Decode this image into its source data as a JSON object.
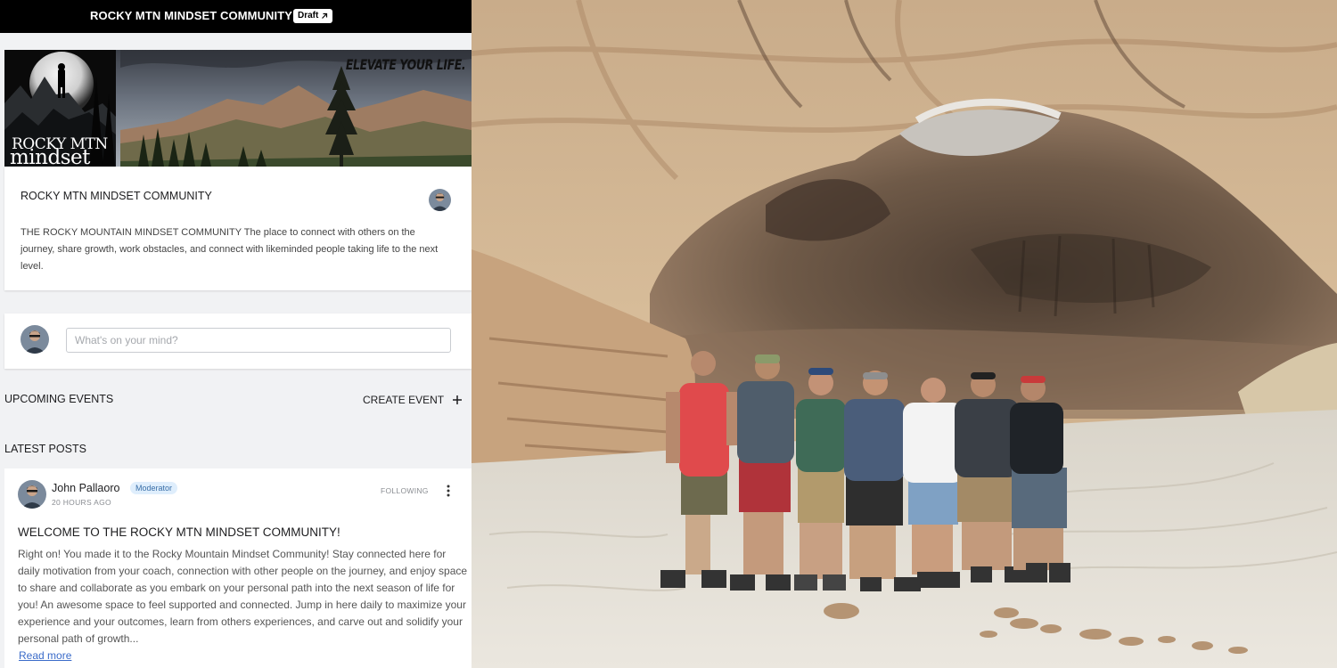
{
  "topbar": {
    "title": "ROCKY MTN MINDSET COMMUNITY",
    "draft_label": "Draft",
    "draft_icon": "external-arrow-icon"
  },
  "banner": {
    "logo_line1": "ROCKY MTN",
    "logo_line2": "mindset",
    "tagline": "ELEVATE YOUR LIFE."
  },
  "community": {
    "name": "ROCKY MTN MINDSET COMMUNITY",
    "description": "THE ROCKY MOUNTAIN MINDSET COMMUNITY The place to connect with others on the journey, share growth, work obstacles, and connect with likeminded people taking life to the next level."
  },
  "composer": {
    "placeholder": "What's on your mind?"
  },
  "events": {
    "heading": "UPCOMING EVENTS",
    "create_label": "CREATE EVENT",
    "create_icon": "plus-icon"
  },
  "posts": {
    "heading": "LATEST POSTS",
    "items": [
      {
        "author": "John Pallaoro",
        "role_badge": "Moderator",
        "time": "20 HOURS AGO",
        "follow_status": "FOLLOWING",
        "title": "WELCOME TO THE ROCKY MTN MINDSET COMMUNITY!",
        "body": "Right on! You made it to the Rocky Mountain Mindset Community! Stay connected here for daily motivation from your coach, connection with other people on the journey, and enjoy space to share and collaborate as you embark on your personal path into the next season of life for you! An awesome space to feel supported and connected. Jump in here daily to maximize your experience and your outcomes, learn from others experiences, and carve out and solidify your personal path of growth...",
        "read_more": "Read more"
      }
    ]
  },
  "colors": {
    "topbar": "#000000",
    "page_bg": "#f1f2f4",
    "card_bg": "#ffffff",
    "moderator_badge_bg": "#dfeefc",
    "moderator_badge_text": "#3a6fa8",
    "link": "#3a6bc9"
  }
}
